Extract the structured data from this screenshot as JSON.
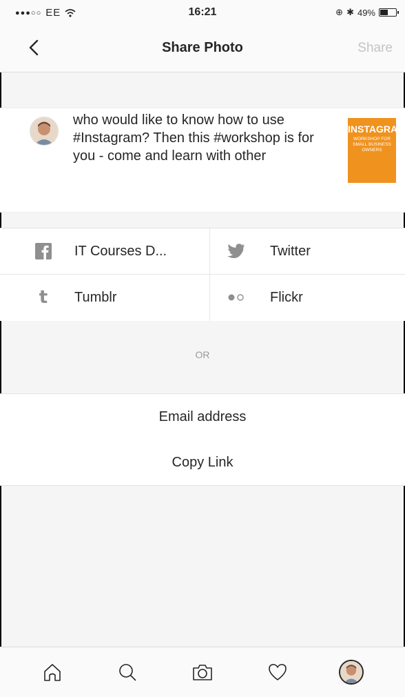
{
  "status_bar": {
    "signal": "●●●○○",
    "carrier": "EE",
    "time": "16:21",
    "battery_text": "49%"
  },
  "nav": {
    "title": "Share Photo",
    "share_label": "Share"
  },
  "caption": {
    "text": "who would like to know how to use #Instagram? Then this #workshop is for you - come and learn with other",
    "thumbnail_title": "INSTAGRAM",
    "thumbnail_sub": "WORKSHOP FOR SMALL BUSINESS OWNERS"
  },
  "services": [
    {
      "label": "IT Courses D...",
      "icon": "facebook-icon"
    },
    {
      "label": "Twitter",
      "icon": "twitter-icon"
    },
    {
      "label": "Tumblr",
      "icon": "tumblr-icon"
    },
    {
      "label": "Flickr",
      "icon": "flickr-icon"
    }
  ],
  "or_label": "OR",
  "email_label": "Email address",
  "copy_link_label": "Copy Link",
  "tabs": [
    "home-icon",
    "search-icon",
    "camera-icon",
    "heart-icon",
    "profile-avatar"
  ],
  "colors": {
    "accent_orange": "#f0921e",
    "share_disabled": "#c4c4c4"
  }
}
